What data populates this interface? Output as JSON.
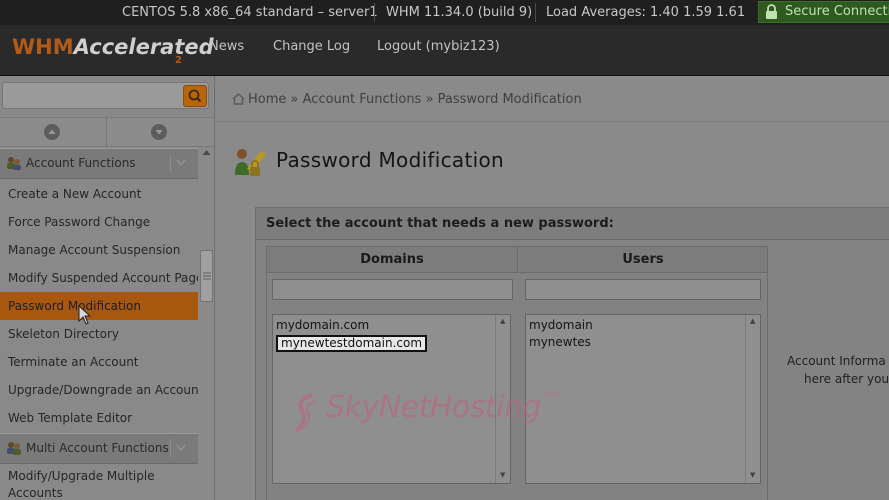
{
  "topbar": {
    "os": "CENTOS 5.8 x86_64 standard – server1",
    "version": "WHM 11.34.0 (build 9)",
    "load": "Load Averages: 1.40 1.59 1.61",
    "secure": "Secure Connectio"
  },
  "header": {
    "logo_whm": "WHM",
    "logo_accelerated": "Accelerated",
    "logo_version": "2",
    "nav": [
      "News",
      "Change Log",
      "Logout (mybiz123)"
    ]
  },
  "sidebar": {
    "search": {
      "value": "",
      "placeholder": ""
    },
    "groups": [
      {
        "label": "Account Functions",
        "items": [
          {
            "label": "Create a New Account"
          },
          {
            "label": "Force Password Change"
          },
          {
            "label": "Manage Account Suspension"
          },
          {
            "label": "Modify Suspended Account Page"
          },
          {
            "label": "Password Modification",
            "active": true
          },
          {
            "label": "Skeleton Directory"
          },
          {
            "label": "Terminate an Account"
          },
          {
            "label": "Upgrade/Downgrade an Account"
          },
          {
            "label": "Web Template Editor"
          }
        ]
      },
      {
        "label": "Multi Account Functions",
        "items": [
          {
            "label": "Modify/Upgrade Multiple Accounts"
          }
        ]
      }
    ]
  },
  "breadcrumb": {
    "items": [
      "Home",
      "Account Functions",
      "Password Modification"
    ],
    "separator": "»"
  },
  "page": {
    "title": "Password Modification",
    "panel_title": "Select the account that needs a new password:",
    "columns": [
      "Domains",
      "Users"
    ],
    "domains": {
      "filter_value": "",
      "options": [
        {
          "label": "mydomain.com",
          "selected": false
        },
        {
          "label": "mynewtestdomain.com",
          "selected": true
        }
      ]
    },
    "users": {
      "filter_value": "",
      "options": [
        {
          "label": "mydomain",
          "selected": false
        },
        {
          "label": "mynewtes",
          "selected": false
        }
      ]
    },
    "info_text_line1": "Account Informa",
    "info_text_line2": "here after you"
  },
  "watermark": {
    "text": "SkyNetHosting",
    "suffix": ".net"
  },
  "colors": {
    "accent": "#b8650c",
    "active_item": "#a8570e",
    "topbar": "#1f1f1f",
    "secure": "#2e5a1f"
  }
}
